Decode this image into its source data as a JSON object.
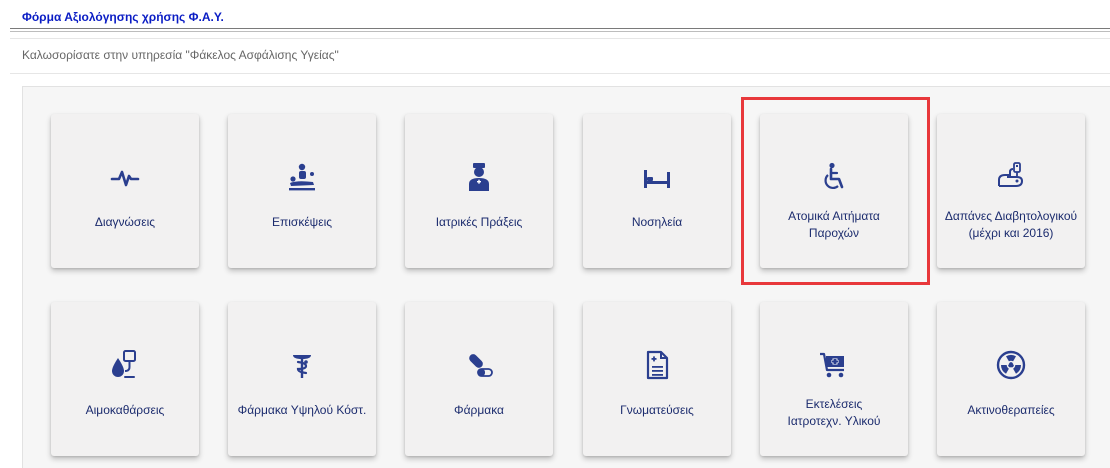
{
  "header": {
    "form_link": "Φόρμα Αξιολόγησης χρήσης Φ.Α.Υ."
  },
  "welcome": {
    "text": "Καλωσορίσατε στην υπηρεσία \"Φάκελος Ασφάλισης Υγείας\""
  },
  "colors": {
    "link": "#0a1cc4",
    "icon": "#2b3f8f",
    "label": "#1c2c6e",
    "tile_bg": "#f2f1f1",
    "highlight": "#e8383b"
  },
  "tiles_row1": [
    {
      "label": "Διαγνώσεις",
      "icon": "heartbeat-icon"
    },
    {
      "label": "Επισκέψεις",
      "icon": "patient-bed-icon"
    },
    {
      "label": "Ιατρικές Πράξεις",
      "icon": "doctor-icon"
    },
    {
      "label": "Νοσηλεία",
      "icon": "hospital-bed-icon"
    },
    {
      "label_line1": "Ατομικά Αιτήματα",
      "label_line2": "Παροχών",
      "icon": "wheelchair-icon"
    },
    {
      "label_line1": "Δαπάνες Διαβητολογικού",
      "label_line2": "(μέχρι και 2016)",
      "icon": "diabetes-icon"
    }
  ],
  "tiles_row2": [
    {
      "label": "Αιμοκαθάρσεις",
      "icon": "dialysis-icon"
    },
    {
      "label": "Φάρμακα Υψηλού Κόστ.",
      "icon": "caduceus-icon"
    },
    {
      "label": "Φάρμακα",
      "icon": "pills-icon"
    },
    {
      "label": "Γνωματεύσεις",
      "icon": "medical-document-icon"
    },
    {
      "label_line1": "Εκτελέσεις",
      "label_line2": "Ιατροτεχν. Υλικού",
      "icon": "medical-cart-icon"
    },
    {
      "label": "Ακτινοθεραπείες",
      "icon": "radiation-icon"
    }
  ]
}
